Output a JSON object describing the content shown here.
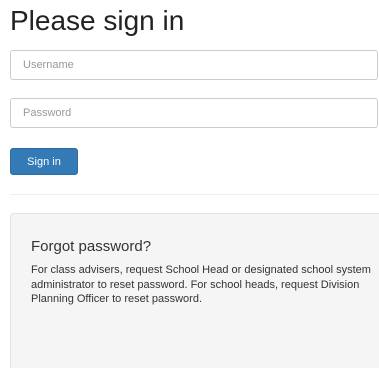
{
  "login": {
    "title": "Please sign in",
    "username_placeholder": "Username",
    "password_placeholder": "Password",
    "sign_in_label": "Sign in"
  },
  "forgot": {
    "title": "Forgot password?",
    "text": "For class advisers, request School Head or designated school system administrator to reset password. For school heads, request Division Planning Officer to reset password."
  },
  "colors": {
    "primary": "#337ab7",
    "well_background": "#f5f5f5"
  }
}
